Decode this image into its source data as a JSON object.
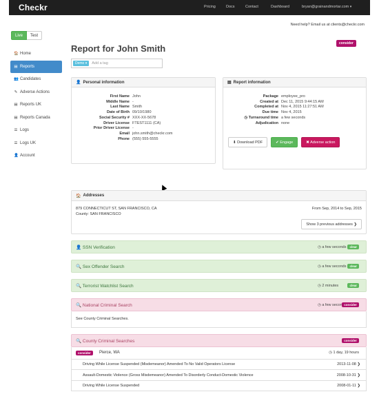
{
  "nav": {
    "logo": "Checkr",
    "links": [
      "Pricing",
      "Docs",
      "Contact",
      "Dashboard"
    ],
    "user": "bryan@grainandmortar.com",
    "caret": "▾"
  },
  "help": "Need help? Email us at clients@checkr.com",
  "mode": {
    "live": "Live",
    "test": "Test"
  },
  "sidebar": {
    "items": [
      {
        "label": "Home",
        "icon": "🏠"
      },
      {
        "label": "Reports",
        "icon": "▤"
      },
      {
        "label": "Candidates",
        "icon": "👥"
      },
      {
        "label": "Adverse Actions",
        "icon": "✎"
      },
      {
        "label": "Reports UK",
        "icon": "▤"
      },
      {
        "label": "Reports Canada",
        "icon": "▤"
      },
      {
        "label": "Logs",
        "icon": "☰"
      },
      {
        "label": "Logs UK",
        "icon": "☰"
      },
      {
        "label": "Account",
        "icon": "👤"
      }
    ]
  },
  "title": "Report for John Smith",
  "title_badge": "consider",
  "tags": {
    "demo": "Demo ▾",
    "placeholder": "Add a tag"
  },
  "personal": {
    "title": "Personal information",
    "icon": "👤",
    "fields": [
      {
        "k": "First Name",
        "v": "John"
      },
      {
        "k": "Middle Name",
        "v": "-"
      },
      {
        "k": "Last Name",
        "v": "Smith"
      },
      {
        "k": "Date of Birth",
        "v": "09/10/1980"
      },
      {
        "k": "Social Security #",
        "v": "XXX-XX-5678"
      },
      {
        "k": "Driver License",
        "v": "FTEST1111 (CA)"
      },
      {
        "k": "Prior Driver License",
        "v": "-"
      },
      {
        "k": "Email",
        "v": "john.smith@checkr.com"
      },
      {
        "k": "Phone",
        "v": "(555) 555-5555"
      }
    ]
  },
  "report": {
    "title": "Report information",
    "icon": "▤",
    "fields": [
      {
        "k": "Package",
        "v": "employee_pro"
      },
      {
        "k": "Created at",
        "v": "Dec 11, 2015 9:44:15 AM"
      },
      {
        "k": "Completed at",
        "v": "Nov 4, 2015 11:27:51 AM"
      },
      {
        "k": "Due time",
        "v": "Nov 4, 2015"
      },
      {
        "k": "◷ Turnaround time",
        "v": "a few seconds"
      },
      {
        "k": "Adjudication",
        "v": "none"
      }
    ],
    "buttons": {
      "download": "⬇ Download PDF",
      "engage": "✔ Engage",
      "adverse": "✖ Adverse action"
    }
  },
  "addresses": {
    "title": "Addresses",
    "icon": "🏠",
    "street": "879 CONNECTICUT ST, SAN FRANCISCO, CA",
    "county": "County: SAN FRANCISCO",
    "range": "From Sep, 2014 to Sep, 2015",
    "show_more": "Show 3 previous addresses ❯"
  },
  "screenings": [
    {
      "name": "SSN Verification",
      "icon": "👤",
      "time": "◷ a few seconds",
      "status": "clear"
    },
    {
      "name": "Sex Offender Search",
      "icon": "🔍",
      "time": "◷ a few seconds",
      "status": "clear"
    },
    {
      "name": "Terrorist Watchlist Search",
      "icon": "🔍",
      "time": "◷ 2 minutes",
      "status": "clear"
    },
    {
      "name": "National Criminal Search",
      "icon": "🔍",
      "time": "◷ a few seconds",
      "status": "consider"
    }
  ],
  "national_note": "See County Criminal Searches.",
  "county": {
    "name": "County Criminal Searches",
    "icon": "🔍",
    "status": "consider",
    "location_badge": "consider",
    "location": "Pierce, WA",
    "turnaround": "◷ 1 day, 19 hours",
    "records": [
      {
        "desc": "Driving While License Suspended (Misdemeanor) Amended To No Valid Operators License",
        "date": "2013-11-08 ❯"
      },
      {
        "desc": "Assault-Domestic Violence (Gross Misdemeanor) Amended To Disorderly Conduct-Domestic Violence",
        "date": "2008-10-31 ❯"
      },
      {
        "desc": "Driving While License Suspended",
        "date": "2008-01-11 ❯"
      }
    ]
  }
}
